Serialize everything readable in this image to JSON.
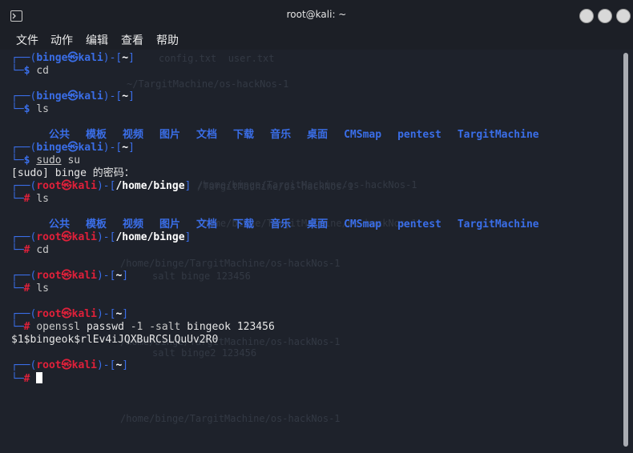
{
  "window": {
    "title": "root@kali: ~"
  },
  "menu": [
    "文件",
    "动作",
    "编辑",
    "查看",
    "帮助"
  ],
  "user": "binge",
  "root_user": "root",
  "host": "kali",
  "home_dir": "~",
  "binge_home": "/home/binge",
  "cmd_cd": "cd",
  "cmd_ls": "ls",
  "cmd_sudo": "sudo",
  "cmd_su": "su",
  "sudo_prompt": "[sudo] binge 的密码：",
  "ls_items": [
    "公共",
    "模板",
    "视频",
    "图片",
    "文档",
    "下载",
    "音乐",
    "桌面",
    "CMSmap",
    "pentest",
    "TargitMachine"
  ],
  "openssl": {
    "cmd": "openssl",
    "sub": "passwd",
    "opt1": "-1",
    "opt2": "-salt",
    "salt": "bingeok",
    "pass": "123456"
  },
  "hash_output": "$1$bingeok$rlEv4iJQXBuRCSLQuUv2R0",
  "ghost_lines": [
    "config.txt  user.txt",
    "~/TargitMachine/os-hackNos-1",
    "/TargitMachine/os-hackNos-1",
    "/home/binge/TargitMachine/os-hackNos-1",
    "/home/binge/TargitMachine/os-hackNos-1",
    "/home/binge/TargitMachine/os-hackNos-1",
    "/home/binge/TargitMachine/os-hackNos-1",
    "salt binge 123456",
    "salt binge2 123456",
    "/home/binge/TargitMachine/os-hackNos-1"
  ]
}
